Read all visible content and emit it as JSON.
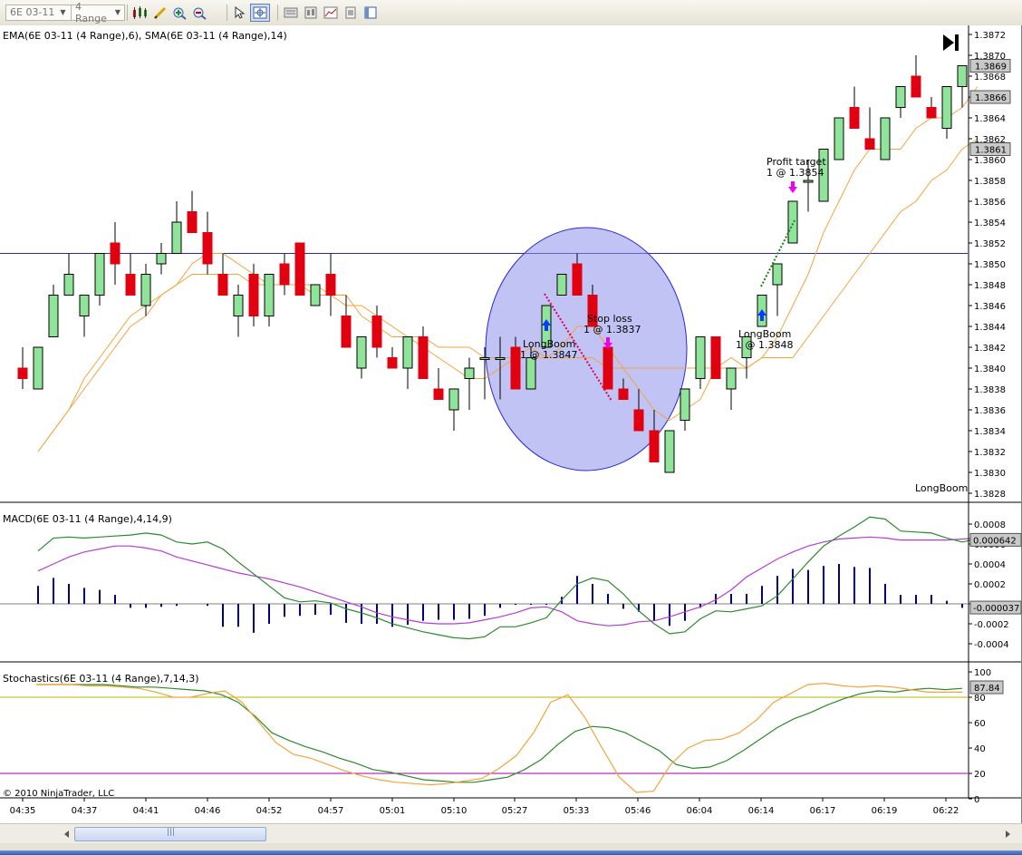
{
  "toolbar": {
    "instrument": "6E 03-11",
    "bar_type": "4 Range",
    "icons": [
      "bar-style-icon",
      "drawing-tool-icon",
      "zoom-in-icon",
      "zoom-out-icon",
      "cursor-icon",
      "crosshair-icon",
      "data-box-icon",
      "properties-icon",
      "indicators-icon",
      "strategies-icon",
      "notes-icon"
    ]
  },
  "colors": {
    "bull": "#90e49a",
    "bear": "#e00010",
    "ema": "#f4a33c",
    "sma": "#f4a33c",
    "macd": "#2c8a2c",
    "signal": "#b23fd6",
    "hist": "#000080",
    "stoch_d": "#2c8a2c",
    "stoch_k": "#f4a33c",
    "hline": "#2b2ba8",
    "ellipse": "#8f91ec"
  },
  "price_panel": {
    "label": "EMA(6E 03-11 (4 Range),6), SMA(6E 03-11 (4 Range),14)",
    "y_ticks": [
      "1.3872",
      "1.3870",
      "1.3868",
      "1.3866",
      "1.3864",
      "1.3862",
      "1.3860",
      "1.3858",
      "1.3856",
      "1.3854",
      "1.3852",
      "1.3850",
      "1.3848",
      "1.3846",
      "1.3844",
      "1.3842",
      "1.3840",
      "1.3838",
      "1.3836",
      "1.3834",
      "1.3832",
      "1.3830",
      "1.3828"
    ],
    "markers": [
      "1.3869",
      "1.3866",
      "1.3861"
    ],
    "strategy_name": "LongBoom",
    "horizontal_line": 1.3851,
    "annotations": [
      {
        "line1": "Profit target",
        "line2": "1 @ 1.3854"
      },
      {
        "line1": "Stop loss",
        "line2": "1 @ 1.3837"
      },
      {
        "line1": "LongBoom",
        "line2": "1 @ 1.3847"
      },
      {
        "line1": "LongBoom",
        "line2": "1 @ 1.3848"
      }
    ]
  },
  "macd_panel": {
    "label": "MACD(6E 03-11 (4 Range),4,14,9)",
    "y_ticks": [
      "0.0008",
      "0.0006",
      "0.0004",
      "0.0002",
      "0",
      "-0.0002",
      "-0.0004"
    ],
    "markers": [
      "0.000642",
      "-0.000037"
    ]
  },
  "stoch_panel": {
    "label": "Stochastics(6E 03-11 (4 Range),7,14,3)",
    "y_ticks": [
      "100",
      "80",
      "60",
      "40",
      "20",
      "0"
    ],
    "marker": "87.84",
    "levels": [
      80,
      20
    ]
  },
  "copyright": "© 2010 NinjaTrader, LLC",
  "x_ticks": [
    "04:35",
    "04:37",
    "04:41",
    "04:46",
    "04:52",
    "04:57",
    "05:01",
    "05:10",
    "05:27",
    "05:33",
    "05:46",
    "06:04",
    "06:14",
    "06:17",
    "06:19",
    "06:22"
  ],
  "chart_data": [
    {
      "type": "candlestick",
      "title": "EMA(6E 03-11 (4 Range),6), SMA(6E 03-11 (4 Range),14)",
      "ylim": [
        1.3827,
        1.3873
      ],
      "candles": [
        {
          "o": 1.384,
          "h": 1.3842,
          "l": 1.3838,
          "c": 1.3839
        },
        {
          "o": 1.3838,
          "h": 1.3842,
          "l": 1.3838,
          "c": 1.3842
        },
        {
          "o": 1.3843,
          "h": 1.3848,
          "l": 1.3843,
          "c": 1.3847
        },
        {
          "o": 1.3847,
          "h": 1.3851,
          "l": 1.3847,
          "c": 1.3849
        },
        {
          "o": 1.3845,
          "h": 1.3847,
          "l": 1.3843,
          "c": 1.3847
        },
        {
          "o": 1.3847,
          "h": 1.3851,
          "l": 1.3846,
          "c": 1.3851
        },
        {
          "o": 1.3852,
          "h": 1.3854,
          "l": 1.3848,
          "c": 1.385
        },
        {
          "o": 1.3849,
          "h": 1.3851,
          "l": 1.3847,
          "c": 1.3847
        },
        {
          "o": 1.3846,
          "h": 1.385,
          "l": 1.3845,
          "c": 1.3849
        },
        {
          "o": 1.385,
          "h": 1.3852,
          "l": 1.3849,
          "c": 1.3851
        },
        {
          "o": 1.3851,
          "h": 1.3856,
          "l": 1.3851,
          "c": 1.3854
        },
        {
          "o": 1.3855,
          "h": 1.3857,
          "l": 1.3853,
          "c": 1.3853
        },
        {
          "o": 1.3853,
          "h": 1.3855,
          "l": 1.3849,
          "c": 1.385
        },
        {
          "o": 1.3849,
          "h": 1.3851,
          "l": 1.3847,
          "c": 1.3847
        },
        {
          "o": 1.3845,
          "h": 1.3848,
          "l": 1.3843,
          "c": 1.3847
        },
        {
          "o": 1.3849,
          "h": 1.385,
          "l": 1.3844,
          "c": 1.3845
        },
        {
          "o": 1.3845,
          "h": 1.3849,
          "l": 1.3844,
          "c": 1.3849
        },
        {
          "o": 1.385,
          "h": 1.3851,
          "l": 1.3847,
          "c": 1.3848
        },
        {
          "o": 1.3852,
          "h": 1.3852,
          "l": 1.3847,
          "c": 1.3847
        },
        {
          "o": 1.3846,
          "h": 1.3848,
          "l": 1.3846,
          "c": 1.3848
        },
        {
          "o": 1.3849,
          "h": 1.3851,
          "l": 1.3845,
          "c": 1.3847
        },
        {
          "o": 1.3845,
          "h": 1.3847,
          "l": 1.3842,
          "c": 1.3842
        },
        {
          "o": 1.384,
          "h": 1.3843,
          "l": 1.3839,
          "c": 1.3843
        },
        {
          "o": 1.3845,
          "h": 1.3846,
          "l": 1.3841,
          "c": 1.3842
        },
        {
          "o": 1.3841,
          "h": 1.3842,
          "l": 1.384,
          "c": 1.384
        },
        {
          "o": 1.384,
          "h": 1.3842,
          "l": 1.3838,
          "c": 1.3843
        },
        {
          "o": 1.3843,
          "h": 1.3844,
          "l": 1.3839,
          "c": 1.3839
        },
        {
          "o": 1.3838,
          "h": 1.384,
          "l": 1.3837,
          "c": 1.3837
        },
        {
          "o": 1.3836,
          "h": 1.3838,
          "l": 1.3834,
          "c": 1.3838
        },
        {
          "o": 1.3839,
          "h": 1.3841,
          "l": 1.3836,
          "c": 1.384
        },
        {
          "o": 1.3841,
          "h": 1.3842,
          "l": 1.3837,
          "c": 1.3841
        },
        {
          "o": 1.3841,
          "h": 1.3843,
          "l": 1.3837,
          "c": 1.3841
        },
        {
          "o": 1.3842,
          "h": 1.3843,
          "l": 1.3838,
          "c": 1.3838
        },
        {
          "o": 1.3838,
          "h": 1.3842,
          "l": 1.3838,
          "c": 1.3841
        },
        {
          "o": 1.3842,
          "h": 1.3846,
          "l": 1.3842,
          "c": 1.3846
        },
        {
          "o": 1.3847,
          "h": 1.3849,
          "l": 1.3847,
          "c": 1.3849
        },
        {
          "o": 1.385,
          "h": 1.3851,
          "l": 1.3847,
          "c": 1.3847
        },
        {
          "o": 1.3847,
          "h": 1.3848,
          "l": 1.3844,
          "c": 1.3844
        },
        {
          "o": 1.3842,
          "h": 1.3842,
          "l": 1.3838,
          "c": 1.3838
        },
        {
          "o": 1.3838,
          "h": 1.3839,
          "l": 1.3837,
          "c": 1.3837
        },
        {
          "o": 1.3836,
          "h": 1.3838,
          "l": 1.3834,
          "c": 1.3834
        },
        {
          "o": 1.3834,
          "h": 1.3836,
          "l": 1.3831,
          "c": 1.3831
        },
        {
          "o": 1.383,
          "h": 1.3834,
          "l": 1.383,
          "c": 1.3834
        },
        {
          "o": 1.3835,
          "h": 1.3838,
          "l": 1.3834,
          "c": 1.3838
        },
        {
          "o": 1.3839,
          "h": 1.3843,
          "l": 1.3838,
          "c": 1.3843
        },
        {
          "o": 1.3843,
          "h": 1.3843,
          "l": 1.3839,
          "c": 1.3839
        },
        {
          "o": 1.3838,
          "h": 1.384,
          "l": 1.3836,
          "c": 1.384
        },
        {
          "o": 1.3841,
          "h": 1.3843,
          "l": 1.3839,
          "c": 1.3843
        },
        {
          "o": 1.3844,
          "h": 1.3847,
          "l": 1.3844,
          "c": 1.3847
        },
        {
          "o": 1.3848,
          "h": 1.385,
          "l": 1.3845,
          "c": 1.385
        },
        {
          "o": 1.3852,
          "h": 1.3856,
          "l": 1.3852,
          "c": 1.3856
        },
        {
          "o": 1.3858,
          "h": 1.386,
          "l": 1.3855,
          "c": 1.3858
        },
        {
          "o": 1.3856,
          "h": 1.3861,
          "l": 1.3856,
          "c": 1.3861
        },
        {
          "o": 1.386,
          "h": 1.3864,
          "l": 1.386,
          "c": 1.3864
        },
        {
          "o": 1.3865,
          "h": 1.3867,
          "l": 1.3863,
          "c": 1.3863
        },
        {
          "o": 1.3862,
          "h": 1.3865,
          "l": 1.3861,
          "c": 1.3861
        },
        {
          "o": 1.386,
          "h": 1.3864,
          "l": 1.386,
          "c": 1.3864
        },
        {
          "o": 1.3865,
          "h": 1.3867,
          "l": 1.3864,
          "c": 1.3867
        },
        {
          "o": 1.3868,
          "h": 1.387,
          "l": 1.3866,
          "c": 1.3866
        },
        {
          "o": 1.3865,
          "h": 1.3866,
          "l": 1.3864,
          "c": 1.3864
        },
        {
          "o": 1.3863,
          "h": 1.3867,
          "l": 1.3862,
          "c": 1.3867
        },
        {
          "o": 1.3867,
          "h": 1.3869,
          "l": 1.3865,
          "c": 1.3869
        }
      ],
      "ema": [
        1.3832,
        1.3834,
        1.3836,
        1.3839,
        1.3841,
        1.3843,
        1.3845,
        1.3846,
        1.3847,
        1.3848,
        1.385,
        1.3851,
        1.3851,
        1.385,
        1.3849,
        1.3848,
        1.3848,
        1.3848,
        1.3848,
        1.3847,
        1.3847,
        1.3845,
        1.3844,
        1.3843,
        1.3843,
        1.3842,
        1.3841,
        1.384,
        1.3839,
        1.3839,
        1.384,
        1.3841,
        1.3842,
        1.3841,
        1.3842,
        1.3844,
        1.3844,
        1.3842,
        1.384,
        1.3838,
        1.3836,
        1.3835,
        1.3836,
        1.3837,
        1.384,
        1.3841,
        1.384,
        1.3841,
        1.3843,
        1.3846,
        1.3849,
        1.3853,
        1.3856,
        1.3859,
        1.3861,
        1.3861,
        1.3861,
        1.3863,
        1.3864,
        1.3864,
        1.3865,
        1.3867
      ],
      "sma": [
        1.3832,
        1.3834,
        1.3836,
        1.3838,
        1.384,
        1.3842,
        1.3844,
        1.3845,
        1.3847,
        1.3848,
        1.3849,
        1.3849,
        1.3849,
        1.3849,
        1.3848,
        1.3848,
        1.3848,
        1.3848,
        1.3847,
        1.3847,
        1.3846,
        1.3846,
        1.3845,
        1.3844,
        1.3843,
        1.3843,
        1.3842,
        1.3842,
        1.3842,
        1.3841,
        1.3841,
        1.3841,
        1.3841,
        1.3841,
        1.3841,
        1.3841,
        1.3841,
        1.384,
        1.384,
        1.384,
        1.384,
        1.384,
        1.384,
        1.384,
        1.384,
        1.384,
        1.384,
        1.3841,
        1.3841,
        1.3841,
        1.3843,
        1.3845,
        1.3847,
        1.3849,
        1.3851,
        1.3853,
        1.3855,
        1.3856,
        1.3858,
        1.3859,
        1.3861,
        1.3862
      ]
    },
    {
      "type": "line",
      "title": "MACD(6E 03-11 (4 Range),4,14,9)",
      "ylim": [
        -0.00055,
        0.0009
      ],
      "macd": [
        0.00053,
        0.00066,
        0.00067,
        0.00066,
        0.00067,
        0.00068,
        0.00069,
        0.00071,
        0.00069,
        0.00062,
        0.0006,
        0.00062,
        0.00055,
        0.00042,
        0.0003,
        0.00018,
        6e-05,
        2e-05,
        3e-05,
        1e-05,
        -5e-05,
        -9e-05,
        -0.00014,
        -0.0002,
        -0.00024,
        -0.00028,
        -0.00031,
        -0.00034,
        -0.00035,
        -0.00033,
        -0.00023,
        -0.00023,
        -0.00019,
        -0.00014,
        4e-05,
        0.0002,
        0.00026,
        0.00023,
        0.0001,
        -7e-05,
        -0.0002,
        -0.0003,
        -0.00028,
        -0.00015,
        -7e-05,
        -8e-05,
        -5e-05,
        -2e-05,
        8e-05,
        0.00025,
        0.00042,
        0.00058,
        0.00068,
        0.00077,
        0.00087,
        0.00085,
        0.00073,
        0.00072,
        0.00071,
        0.00066,
        0.00062,
        0.00065
      ],
      "signal": [
        0.00033,
        0.0004,
        0.00047,
        0.00052,
        0.00055,
        0.00058,
        0.00058,
        0.00056,
        0.00053,
        0.00047,
        0.00043,
        0.00039,
        0.00035,
        0.00031,
        0.00028,
        0.00025,
        0.00021,
        0.00017,
        0.00012,
        7e-05,
        2e-05,
        -3e-05,
        -9e-05,
        -0.00013,
        -0.00016,
        -0.00019,
        -0.0002,
        -0.0002,
        -0.00019,
        -0.00016,
        -0.00013,
        -9e-05,
        -4e-05,
        -3e-05,
        -8e-05,
        -0.00017,
        -0.0002,
        -0.00022,
        -0.00021,
        -0.00018,
        -0.00017,
        -0.00013,
        -8e-05,
        -3e-05,
        4e-05,
        0.00014,
        0.00027,
        0.00036,
        0.00045,
        0.00052,
        0.00058,
        0.00062,
        0.00065,
        0.00066,
        0.00067,
        0.00066,
        0.00064,
        0.00064,
        0.00064,
        0.00064,
        0.00065,
        0.00066
      ],
      "histogram": [
        0.00018,
        0.00026,
        0.0002,
        0.00016,
        0.00014,
        9e-05,
        -4e-05,
        -4e-05,
        -3e-05,
        -2e-05,
        0.0,
        -2e-05,
        -0.00023,
        -0.00023,
        -0.00029,
        -0.0002,
        -0.00013,
        -0.00012,
        -0.00011,
        -0.00011,
        -0.00019,
        -0.0002,
        -0.0002,
        -0.00023,
        -0.00021,
        -0.00017,
        -0.00016,
        -0.00016,
        -0.00015,
        -0.00012,
        -4e-05,
        -1e-05,
        -1e-05,
        -1e-05,
        7e-05,
        0.00028,
        0.0002,
        0.0001,
        -5e-05,
        -8e-05,
        -0.00017,
        -0.00022,
        -0.00017,
        -4e-05,
        0.0001,
        0.0001,
        0.0001,
        0.00018,
        0.00028,
        0.00035,
        0.00034,
        0.00038,
        0.0004,
        0.00037,
        0.00036,
        0.0002,
        9e-05,
        9e-05,
        9e-05,
        3e-05,
        -4e-05,
        -3e-05
      ]
    },
    {
      "type": "line",
      "title": "Stochastics(6E 03-11 (4 Range),7,14,3)",
      "ylim": [
        0,
        100
      ],
      "d": [
        90,
        90,
        90,
        90,
        90,
        89,
        88,
        88,
        87,
        86,
        85,
        82,
        76,
        65,
        52,
        46,
        41,
        37,
        32,
        28,
        23,
        21,
        18,
        15,
        14,
        13,
        13,
        15,
        17,
        23,
        31,
        43,
        53,
        57,
        56,
        52,
        45,
        38,
        27,
        24,
        25,
        30,
        38,
        47,
        56,
        63,
        68,
        74,
        79,
        83,
        85,
        84,
        86,
        87,
        86,
        87
      ],
      "k": [
        90,
        90,
        90,
        89,
        89,
        88,
        87,
        84,
        80,
        80,
        83,
        85,
        76,
        60,
        44,
        35,
        32,
        27,
        22,
        18,
        15,
        13,
        12,
        11,
        12,
        14,
        16,
        24,
        34,
        52,
        76,
        82,
        64,
        40,
        17,
        5,
        6,
        27,
        40,
        46,
        47,
        52,
        62,
        76,
        83,
        90,
        91,
        89,
        88,
        89,
        88,
        86,
        84,
        84,
        84
      ]
    }
  ]
}
